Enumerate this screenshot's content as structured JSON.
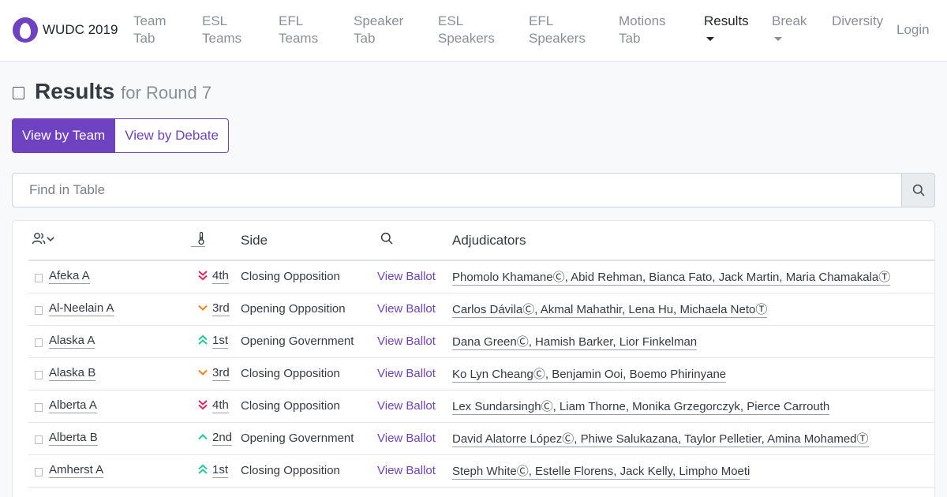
{
  "nav": {
    "brand": "WUDC 2019",
    "items": [
      {
        "l1": "Team",
        "l2": "Tab"
      },
      {
        "l1": "ESL",
        "l2": "Teams"
      },
      {
        "l1": "EFL",
        "l2": "Teams"
      },
      {
        "l1": "Speaker",
        "l2": "Tab"
      },
      {
        "l1": "ESL",
        "l2": "Speakers"
      },
      {
        "l1": "EFL",
        "l2": "Speakers"
      },
      {
        "l1": "Motions",
        "l2": "Tab"
      }
    ],
    "results": "Results",
    "break": "Break",
    "diversity": "Diversity",
    "login": "Login"
  },
  "header": {
    "title": "Results",
    "subtitle": "for Round 7"
  },
  "view_toggle": {
    "by_team": "View by Team",
    "by_debate": "View by Debate"
  },
  "search": {
    "placeholder": "Find in Table"
  },
  "table": {
    "headers": {
      "side": "Side",
      "adjudicators": "Adjudicators"
    },
    "rows": [
      {
        "team": "Afeka A",
        "rank": "4th",
        "trend": "down-double",
        "side": "Closing Opposition",
        "ballot": "View Ballot",
        "adjs": "Phomolo KhamaneⒸ, Abid Rehman, Bianca Fato, Jack Martin, Maria ChamakalaⓉ"
      },
      {
        "team": "Al-Neelain A",
        "rank": "3rd",
        "trend": "down",
        "side": "Opening Opposition",
        "ballot": "View Ballot",
        "adjs": "Carlos DávilaⒸ, Akmal Mahathir, Lena Hu, Michaela NetoⓉ"
      },
      {
        "team": "Alaska A",
        "rank": "1st",
        "trend": "up-double",
        "side": "Opening Government",
        "ballot": "View Ballot",
        "adjs": "Dana GreenⒸ, Hamish Barker, Lior Finkelman"
      },
      {
        "team": "Alaska B",
        "rank": "3rd",
        "trend": "down",
        "side": "Closing Opposition",
        "ballot": "View Ballot",
        "adjs": "Ko Lyn CheangⒸ, Benjamin Ooi, Boemo Phirinyane"
      },
      {
        "team": "Alberta A",
        "rank": "4th",
        "trend": "down-double",
        "side": "Closing Opposition",
        "ballot": "View Ballot",
        "adjs": "Lex SundarsinghⒸ, Liam Thorne, Monika Grzegorczyk, Pierce Carrouth"
      },
      {
        "team": "Alberta B",
        "rank": "2nd",
        "trend": "up",
        "side": "Opening Government",
        "ballot": "View Ballot",
        "adjs": "David Alatorre LópezⒸ, Phiwe Salukazana, Taylor Pelletier, Amina MohamedⓉ"
      },
      {
        "team": "Amherst A",
        "rank": "1st",
        "trend": "up-double",
        "side": "Closing Opposition",
        "ballot": "View Ballot",
        "adjs": "Steph WhiteⒸ, Estelle Florens, Jack Kelly, Limpho Moeti"
      }
    ]
  },
  "colors": {
    "accent": "#6f42c1",
    "down": "#e0245e",
    "down_single": "#fd7e14",
    "up": "#20c997"
  }
}
